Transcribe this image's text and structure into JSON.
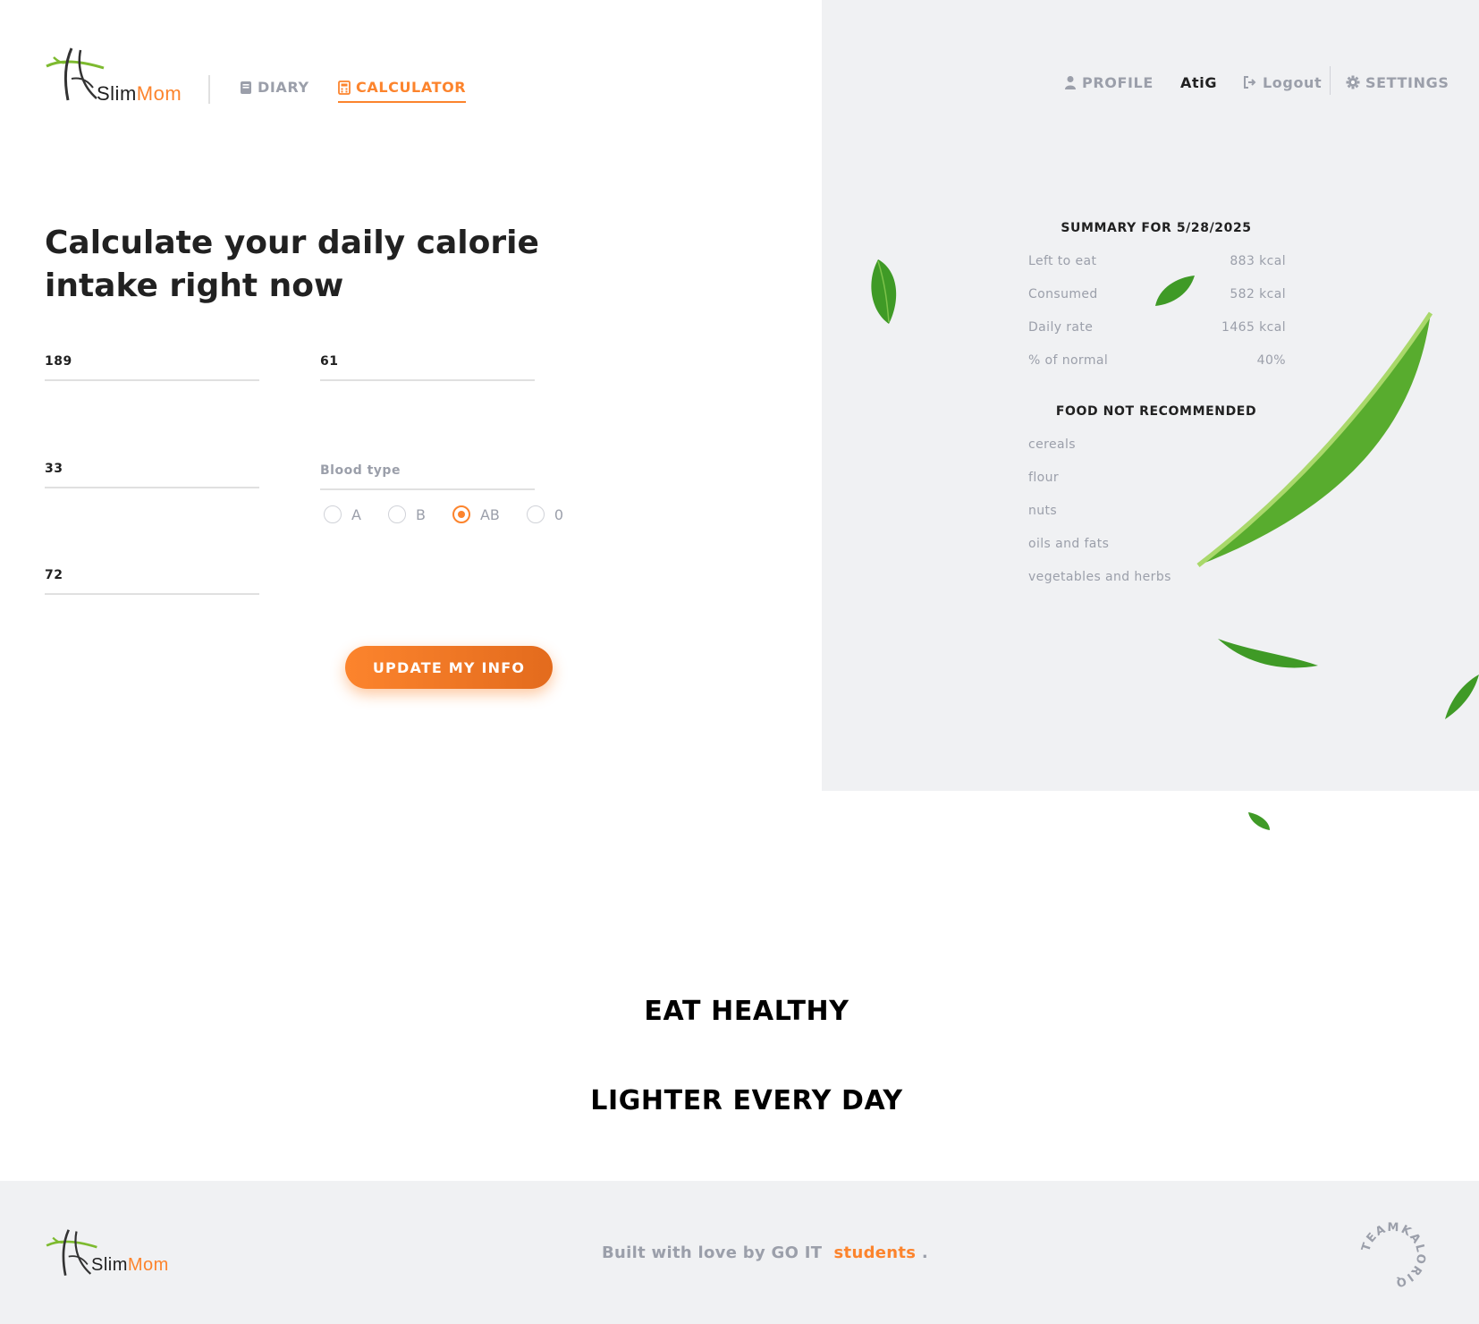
{
  "brand": {
    "slim": "Slim",
    "mom": "Mom"
  },
  "nav": {
    "diary_label": "DIARY",
    "calculator_label": "CALCULATOR",
    "profile_label": "PROFILE",
    "user_name": "AtiG",
    "logout_label": "Logout",
    "settings_label": "SETTINGS"
  },
  "main": {
    "title": "Calculate your daily calorie intake right now",
    "height_value": "189",
    "weight_value": "61",
    "age_value": "33",
    "blood_type_placeholder": "Blood type",
    "desired_weight_value": "72",
    "blood_options": [
      "A",
      "B",
      "AB",
      "0"
    ],
    "blood_selected": "AB",
    "update_label": "UPDATE MY INFO"
  },
  "summary": {
    "title": "SUMMARY FOR 5/28/2025",
    "rows": [
      {
        "label": "Left to eat",
        "value": "883 kcal"
      },
      {
        "label": "Consumed",
        "value": "582 kcal"
      },
      {
        "label": "Daily rate",
        "value": "1465 kcal"
      },
      {
        "label": "% of normal",
        "value": "40%"
      }
    ],
    "food_title": "FOOD NOT RECOMMENDED",
    "food_items": [
      "cereals",
      "flour",
      "nuts",
      "oils and fats",
      "vegetables and herbs"
    ]
  },
  "slogans": {
    "line1": "EAT HEALTHY",
    "line2": "LIGHTER EVERY DAY"
  },
  "footer": {
    "text_prefix": "Built with love by GO IT",
    "text_accent": "students",
    "text_suffix": ".",
    "badge_text": "TEAMKALORIQ"
  },
  "colors": {
    "accent": "#fc842d",
    "muted": "#9b9faa",
    "panel": "#f0f1f3",
    "leaf": "#3f9a26"
  }
}
